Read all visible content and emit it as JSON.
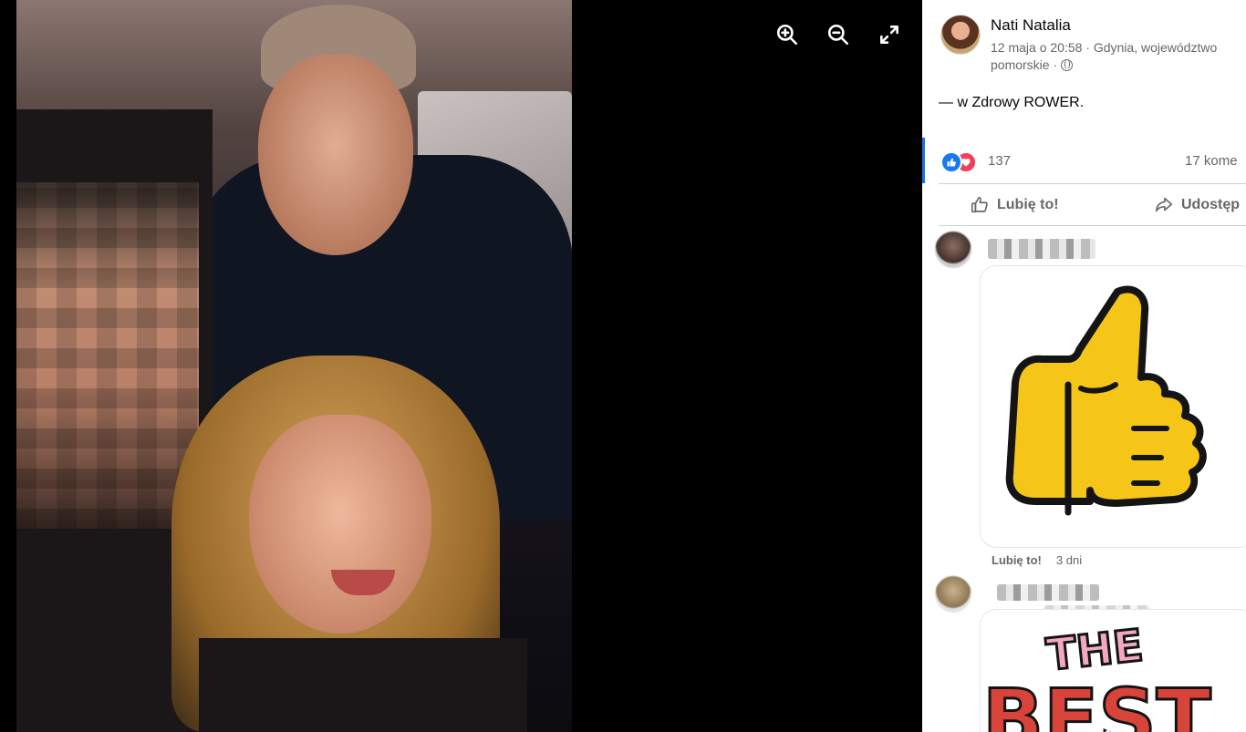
{
  "viewer": {
    "zoom_in_icon": "zoom-in-icon",
    "zoom_out_icon": "zoom-out-icon",
    "fullscreen_icon": "expand-icon"
  },
  "post": {
    "author": "Nati Natalia",
    "date": "12 maja o 20:58",
    "location": "Gdynia, województwo pomorskie",
    "separator": " · ",
    "caption_prefix": "— w ",
    "caption_place": "Zdrowy ROWER",
    "caption_suffix": "."
  },
  "reactions": {
    "count": "137",
    "comments": "17 kome",
    "icons": [
      "like-reaction-icon",
      "love-reaction-icon"
    ]
  },
  "actions": {
    "like_label": "Lubię to!",
    "share_label": "Udostęp"
  },
  "comments": [
    {
      "sticker": "thumbs-up-sticker",
      "like_label": "Lubię to!",
      "time": "3 dni"
    },
    {
      "sticker": "the-best-sticker",
      "sticker_text": "THE BEST"
    }
  ],
  "colors": {
    "accent": "#1b74e4",
    "secondary_text": "#65676b",
    "like_blue": "#1877f2",
    "love_red": "#f33e58",
    "sticker_yellow": "#f5c518",
    "sticker_pink": "#f2a7c3",
    "sticker_red": "#d8443a"
  }
}
